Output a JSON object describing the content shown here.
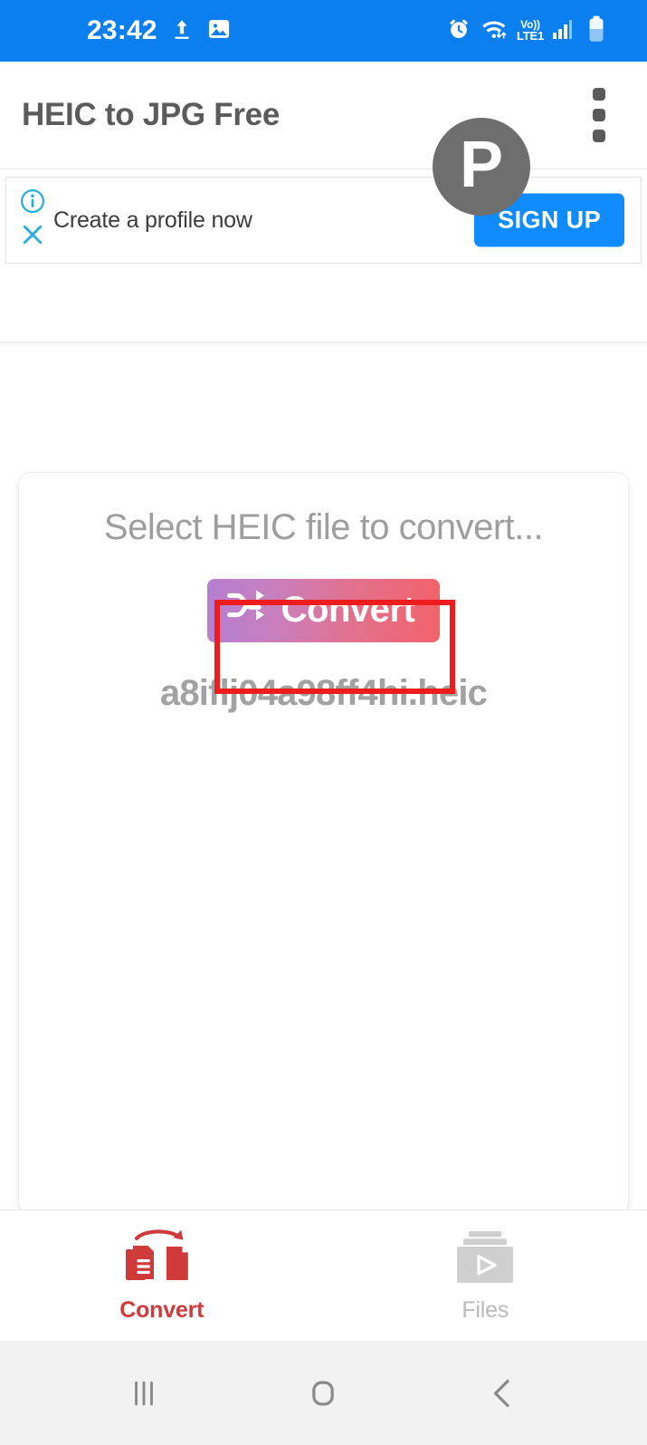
{
  "status_bar": {
    "time": "23:42",
    "left_icons": [
      "upload-icon",
      "photo-icon"
    ],
    "right_icons": [
      "alarm-icon",
      "wifi-icon",
      "volte-icon",
      "signal-icon",
      "battery-icon"
    ],
    "volte_top": "Vo))",
    "volte_bottom": "LTE1",
    "background_color": "#0B7FF0"
  },
  "app_bar": {
    "title": "HEIC to JPG Free",
    "avatar_letter": "P",
    "overflow_icon": "more-vertical-icon"
  },
  "ad_banner": {
    "info_icon": "info-icon",
    "close_icon": "close-icon",
    "message": "Create a profile now",
    "cta_label": "SIGN UP",
    "cta_color": "#0D8BFF"
  },
  "main": {
    "select_hint": "Select HEIC file to convert...",
    "convert_button": {
      "label": "Convert",
      "icon": "shuffle-icon",
      "gradient_from": "#b57fd1",
      "gradient_to": "#f2636a",
      "highlight_color": "#EE1C1C"
    },
    "file_name": "a8iflj04a98ff4hi.heic"
  },
  "tabs": [
    {
      "label": "Convert",
      "icon": "document-convert-icon",
      "active": true,
      "color": "#cf3b3b"
    },
    {
      "label": "Files",
      "icon": "files-play-icon",
      "active": false,
      "color": "#b9b9b9"
    }
  ],
  "nav_bar": {
    "recents_icon": "recents-icon",
    "home_icon": "home-icon",
    "back_icon": "back-icon"
  }
}
